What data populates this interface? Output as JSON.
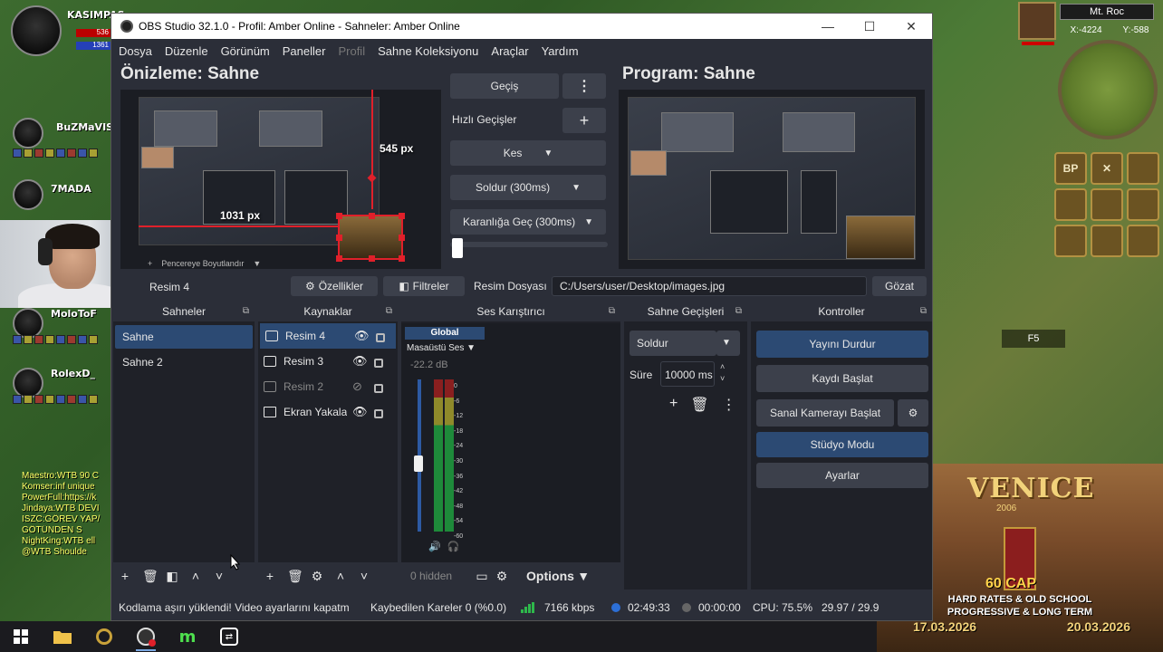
{
  "obs": {
    "window_title": "OBS Studio 32.1.0 - Profil: Amber Online - Sahneler: Amber Online",
    "window_buttons": {
      "minimize": "—",
      "maximize": "☐",
      "close": "✕"
    },
    "menu": [
      "Dosya",
      "Düzenle",
      "Görünüm",
      "Paneller",
      "Profil",
      "Sahne Koleksiyonu",
      "Araçlar",
      "Yardım"
    ],
    "preview_title": "Önizleme: Sahne",
    "program_title": "Program: Sahne",
    "preview_width_label": "1031 px",
    "preview_height_label": "545 px",
    "transitions": {
      "gecis_label": "Geçiş",
      "dots": "⋮",
      "quick_label": "Hızlı Geçişler",
      "add": "+",
      "options": [
        "Kes",
        "Soldur (300ms)",
        "Karanlığa Geç (300ms)"
      ]
    },
    "source_toolbar": {
      "preview_hint": "Pencereye Boyutlandır",
      "selected_source": "Resim 4",
      "properties": "Özellikler",
      "filters": "Filtreler",
      "file_label": "Resim Dosyası",
      "file_path": "C:/Users/user/Desktop/images.jpg",
      "browse": "Gözat"
    },
    "docks": {
      "scenes": {
        "title": "Sahneler",
        "items": [
          "Sahne",
          "Sahne 2"
        ]
      },
      "sources": {
        "title": "Kaynaklar",
        "items": [
          "Resim 4",
          "Resim 3",
          "Resim 2",
          "Ekran Yakala"
        ]
      },
      "mixer": {
        "title": "Ses Karıştırıcı",
        "global": "Global",
        "channel": "Masaüstü Ses",
        "db": "-22.2 dB",
        "scale": [
          "0",
          "-6",
          "-12",
          "-18",
          "-24",
          "-30",
          "-36",
          "-42",
          "-48",
          "-54",
          "-60"
        ],
        "hidden": "0 hidden",
        "options": "Options"
      },
      "scene_transitions": {
        "title": "Sahne Geçişleri",
        "transition": "Soldur",
        "duration_label": "Süre",
        "duration_value": "10000 ms"
      },
      "controls": {
        "title": "Kontroller",
        "stop_stream": "Yayını Durdur",
        "start_record": "Kaydı Başlat",
        "virtual_cam": "Sanal Kamerayı Başlat",
        "studio_mode": "Stüdyo Modu",
        "settings": "Ayarlar"
      }
    },
    "status": {
      "warning": "Kodlama aşırı yüklendi! Video ayarlarını kapatm",
      "dropped": "Kaybedilen Kareler 0 (%0.0)",
      "bitrate": "7166 kbps",
      "stream_time": "02:49:33",
      "rec_time": "00:00:00",
      "cpu": "CPU: 75.5%",
      "fps": "29.97 / 29.9"
    }
  },
  "game": {
    "party": [
      {
        "name": "KASIMPAS",
        "hp": "536",
        "mp": "1361"
      },
      {
        "name": "BuZMaVISI"
      },
      {
        "name": "7MADA"
      },
      {
        "name": "MoloToF"
      },
      {
        "name": "RolexD_"
      }
    ],
    "chat": [
      "Maestro:WTB 90 C",
      "Komser:inf unique",
      "PowerFull:https://k",
      "Jindaya:WTB DEVI",
      "ISZC:GÖREV YAP/",
      "GÖTÜNDEN S",
      "NightKing:WTB ell",
      "@WTB Shoulde"
    ],
    "minimap": {
      "title": "Mt. Roc",
      "x": "X:-4224",
      "y": "Y:-588"
    },
    "skills": [
      "BP",
      "✕",
      "",
      "",
      "",
      "",
      "",
      "",
      ""
    ],
    "fbar": "F5",
    "ad": {
      "logo": "VENICE",
      "year": "2006",
      "cap": "60 CAP",
      "line1": "HARD RATES & OLD SCHOOL",
      "line2": "PROGRESSIVE & LONG TERM",
      "date1": "17.03.2026",
      "date2": "20.03.2026"
    }
  }
}
